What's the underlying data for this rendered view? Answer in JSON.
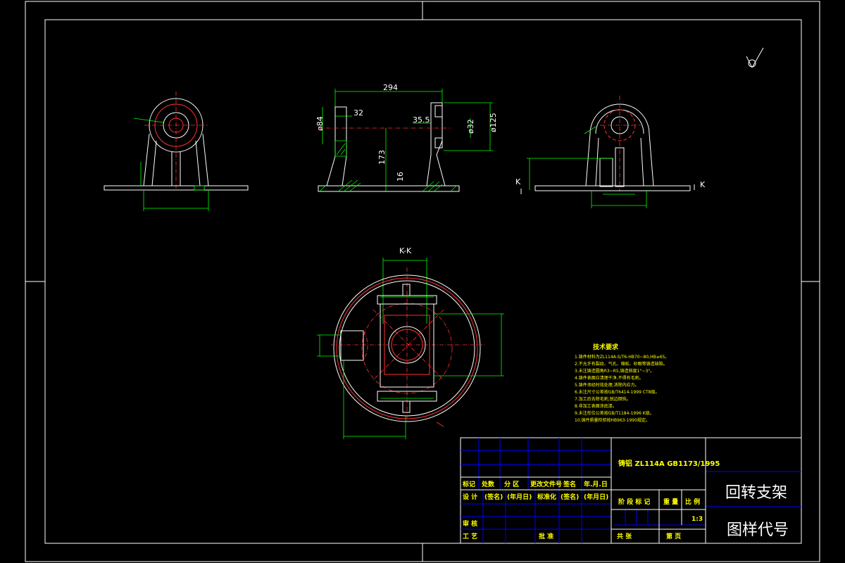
{
  "drawing": {
    "dims_front": {
      "d1": "294",
      "d2": "32",
      "d3": "35.5",
      "d4": "ø84",
      "d5": "ø32",
      "d6": "ø125",
      "d7": "173",
      "d8": "16"
    },
    "section_label": "K-K",
    "section_marks": {
      "left": "K",
      "right": "K"
    },
    "roughness": "✓",
    "tech_req_title": "技术要求",
    "tech_req_items": [
      "1.铸件材料为ZL114A-S/T6-HB70~80,HB≥65。",
      "2.不允许有裂纹、气孔、缩松、砂眼等铸造缺陷。",
      "3.未注铸造圆角R3~R5,铸造斜度1°~3°。",
      "4.铸件表面应清理干净,不得有毛刺。",
      "5.铸件须经时效处理,消除内应力。",
      "6.未注尺寸公差按GB/T6414-1999 CT8级。",
      "7.加工后去除毛刺,锐边倒钝。",
      "8.非加工表面涂底漆。",
      "9.未注形位公差按GB/T1184-1996 K级。",
      "10.铸件质量检验按HB963-1990规定。"
    ],
    "title_block": {
      "material": "铸铝 ZL114A GB1173/1995",
      "part_name": "回转支架",
      "drawing_code": "图样代号",
      "rev_headers": [
        "标记",
        "处数",
        "分 区",
        "更改文件号",
        "签名",
        "年.月.日"
      ],
      "design_row": [
        "设 计",
        "(签名)",
        "(年月日)",
        "标准化",
        "(签名)",
        "(年月日)"
      ],
      "stage_headers": [
        "阶 段 标 记",
        "重 量",
        "比 例"
      ],
      "scale": "1:3",
      "review": "审 核",
      "process": "工 艺",
      "approve": "批 准",
      "sheet_row": [
        "共  张",
        "第  页"
      ]
    }
  }
}
